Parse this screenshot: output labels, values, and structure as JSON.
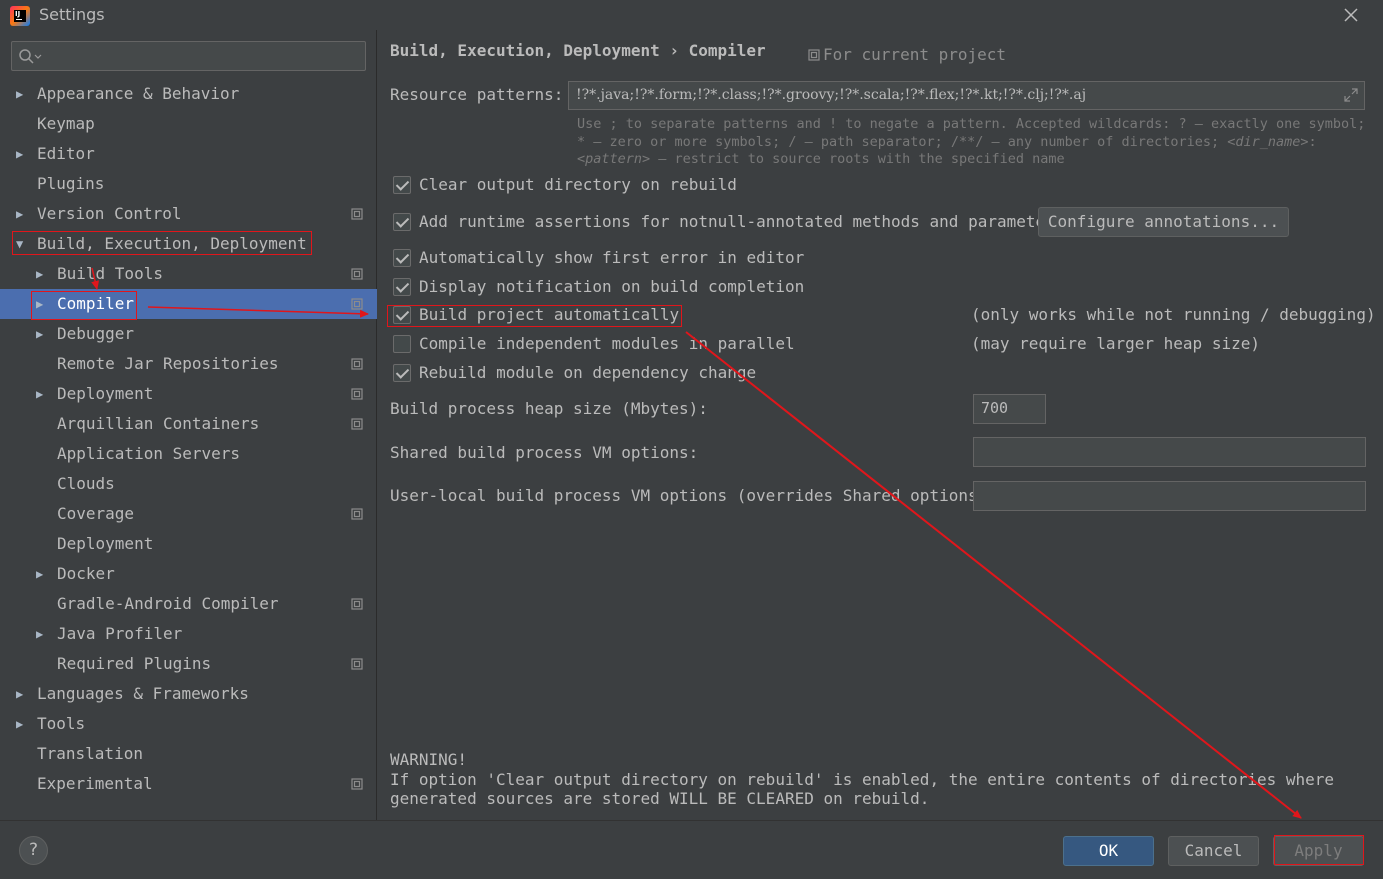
{
  "window": {
    "title": "Settings",
    "app_icon_text": "IJ"
  },
  "search": {
    "placeholder": ""
  },
  "sidebar": {
    "items": [
      {
        "label": "Appearance & Behavior",
        "arrow": "▶",
        "level": 0,
        "project": false
      },
      {
        "label": "Keymap",
        "arrow": "",
        "level": 0,
        "project": false
      },
      {
        "label": "Editor",
        "arrow": "▶",
        "level": 0,
        "project": false
      },
      {
        "label": "Plugins",
        "arrow": "",
        "level": 0,
        "project": false
      },
      {
        "label": "Version Control",
        "arrow": "▶",
        "level": 0,
        "project": true
      },
      {
        "label": "Build, Execution, Deployment",
        "arrow": "▼",
        "level": 0,
        "project": false
      },
      {
        "label": "Build Tools",
        "arrow": "▶",
        "level": 1,
        "project": true
      },
      {
        "label": "Compiler",
        "arrow": "▶",
        "level": 1,
        "project": true,
        "selected": true
      },
      {
        "label": "Debugger",
        "arrow": "▶",
        "level": 1,
        "project": false
      },
      {
        "label": "Remote Jar Repositories",
        "arrow": "",
        "level": 1,
        "project": true
      },
      {
        "label": "Deployment",
        "arrow": "▶",
        "level": 1,
        "project": true
      },
      {
        "label": "Arquillian Containers",
        "arrow": "",
        "level": 1,
        "project": true
      },
      {
        "label": "Application Servers",
        "arrow": "",
        "level": 1,
        "project": false
      },
      {
        "label": "Clouds",
        "arrow": "",
        "level": 1,
        "project": false
      },
      {
        "label": "Coverage",
        "arrow": "",
        "level": 1,
        "project": true
      },
      {
        "label": "Deployment",
        "arrow": "",
        "level": 1,
        "project": false
      },
      {
        "label": "Docker",
        "arrow": "▶",
        "level": 1,
        "project": false
      },
      {
        "label": "Gradle-Android Compiler",
        "arrow": "",
        "level": 1,
        "project": true
      },
      {
        "label": "Java Profiler",
        "arrow": "▶",
        "level": 1,
        "project": false
      },
      {
        "label": "Required Plugins",
        "arrow": "",
        "level": 1,
        "project": true
      },
      {
        "label": "Languages & Frameworks",
        "arrow": "▶",
        "level": 0,
        "project": false
      },
      {
        "label": "Tools",
        "arrow": "▶",
        "level": 0,
        "project": false
      },
      {
        "label": "Translation",
        "arrow": "",
        "level": 0,
        "project": false
      },
      {
        "label": "Experimental",
        "arrow": "",
        "level": 0,
        "project": true
      }
    ]
  },
  "content": {
    "breadcrumb": "Build, Execution, Deployment › Compiler",
    "scope_label": "For current project",
    "resource_patterns": {
      "label": "Resource patterns:",
      "value": "!?*.java;!?*.form;!?*.class;!?*.groovy;!?*.scala;!?*.flex;!?*.kt;!?*.clj;!?*.aj"
    },
    "hint": {
      "line1": "Use ; to separate patterns and ! to negate a pattern. Accepted wildcards: ? — exactly one symbol;",
      "line2a": "* — zero or more symbols; / — path separator; /**/ — any number of directories; ",
      "line2b": "<dir_name>",
      "line2c": ":",
      "line3a": "<pattern>",
      "line3b": " — restrict to source roots with the specified name"
    },
    "options": [
      {
        "label": "Clear output directory on rebuild",
        "checked": true
      },
      {
        "label": "Add runtime assertions for notnull-annotated methods and parameters",
        "checked": true
      },
      {
        "label": "Automatically show first error in editor",
        "checked": true
      },
      {
        "label": "Display notification on build completion",
        "checked": true
      },
      {
        "label": "Build project automatically",
        "checked": true
      },
      {
        "label": "Compile independent modules in parallel",
        "checked": false
      },
      {
        "label": "Rebuild module on dependency change",
        "checked": true
      }
    ],
    "configure_annotations_label": "Configure annotations...",
    "note_auto_build": "(only works while not running / debugging)",
    "note_parallel": "(may require larger heap size)",
    "heap_size": {
      "label": "Build process heap size (Mbytes):",
      "value": "700"
    },
    "shared_vm": {
      "label": "Shared build process VM options:",
      "value": ""
    },
    "user_vm": {
      "label": "User-local build process VM options (overrides Shared options):",
      "value": ""
    },
    "warning": {
      "line1": "WARNING!",
      "line2": "If option 'Clear output directory on rebuild' is enabled, the entire contents of directories where",
      "line3": "generated sources are stored WILL BE CLEARED on rebuild."
    }
  },
  "footer": {
    "help_label": "?",
    "ok_label": "OK",
    "cancel_label": "Cancel",
    "apply_label": "Apply"
  },
  "colors": {
    "background": "#3c3f41",
    "selection": "#4b6eaf",
    "primary_button": "#365880",
    "annotation": "#e0161b"
  }
}
